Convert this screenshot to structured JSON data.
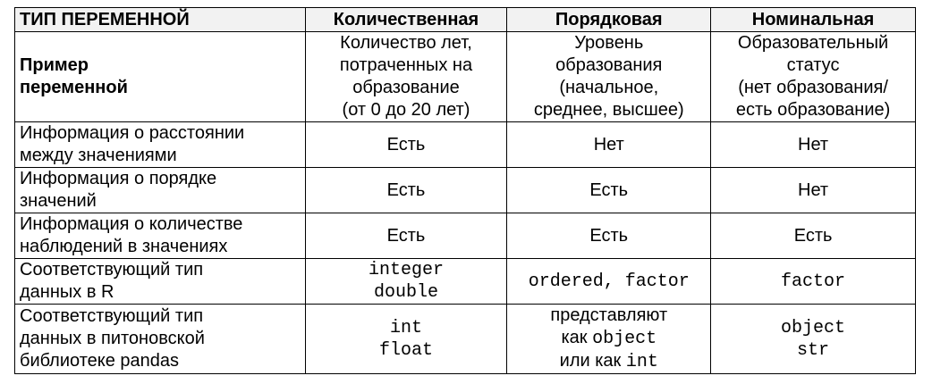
{
  "header": {
    "col0": "ТИП ПЕРЕМЕННОЙ",
    "col1": "Количественная",
    "col2": "Порядковая",
    "col3": "Номинальная"
  },
  "rows": [
    {
      "label": [
        "Пример",
        "переменной"
      ],
      "c1": [
        "Количество лет,",
        "потраченных на",
        "образование",
        "(от 0 до 20 лет)"
      ],
      "c2": [
        "Уровень",
        "образования",
        "(начальное,",
        "среднее, высшее)"
      ],
      "c3": [
        "Образовательный",
        "статус",
        "(нет образования/",
        "есть образование)"
      ]
    },
    {
      "label": [
        "Информация о расстоянии",
        "между значениями"
      ],
      "c1": "Есть",
      "c2": "Нет",
      "c3": "Нет"
    },
    {
      "label": [
        "Информация о порядке",
        "значений"
      ],
      "c1": "Есть",
      "c2": "Есть",
      "c3": "Нет"
    },
    {
      "label": [
        "Информация о количестве",
        "наблюдений в значениях"
      ],
      "c1": "Есть",
      "c2": "Есть",
      "c3": "Есть"
    },
    {
      "label": [
        "Соответствующий тип",
        "данных в R"
      ],
      "c1": [
        "integer",
        "double"
      ],
      "c2": "ordered, factor",
      "c3": "factor"
    },
    {
      "label": [
        "Соответствующий тип",
        "данных в питоновской",
        "библиотеке pandas"
      ],
      "c1": [
        "int",
        "float"
      ],
      "c2": {
        "line1": "представляют",
        "line2_text": "как ",
        "line2_code": "object",
        "line3_text": "или как ",
        "line3_code": "int"
      },
      "c3": [
        "object",
        "str"
      ]
    }
  ]
}
